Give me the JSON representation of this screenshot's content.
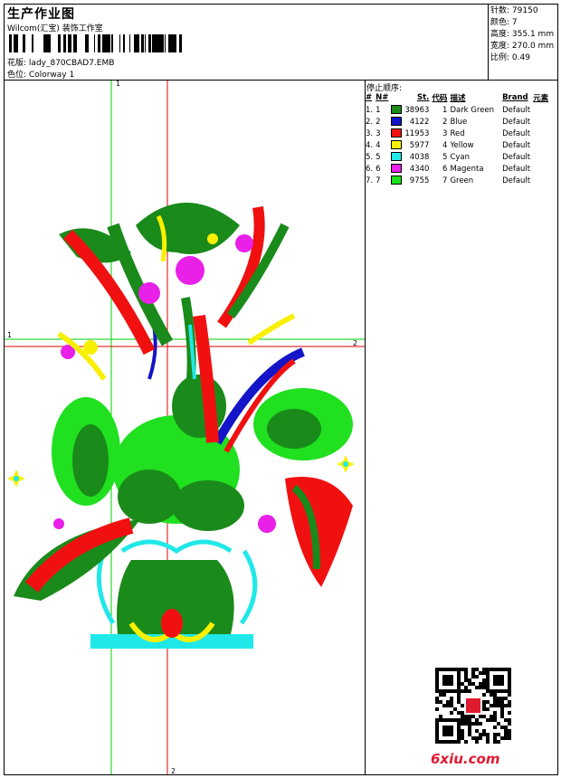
{
  "header": {
    "title": "生产作业图",
    "subtitle": "Wilcom(汇宝) 装饰工作室",
    "design_label": "花版:",
    "design_value": "lady_870CBAD7.EMB",
    "colorway_label": "色位:",
    "colorway_value": "Colorway 1"
  },
  "stats": [
    {
      "label": "针数:",
      "value": "79150"
    },
    {
      "label": "颜色:",
      "value": "7"
    },
    {
      "label": "高度:",
      "value": "355.1 mm"
    },
    {
      "label": "宽度:",
      "value": "270.0 mm"
    },
    {
      "label": "比例:",
      "value": "0.49"
    }
  ],
  "stop_sequence": {
    "title": "停止顺序:",
    "columns": [
      "#",
      "N#",
      "St.",
      "代码",
      "描述",
      "Brand",
      "元素"
    ],
    "rows": [
      {
        "idx": "1.",
        "n": "1",
        "color": "#1a8a1a",
        "stitches": "38963",
        "code": "1",
        "desc": "Dark Green",
        "brand": "Default"
      },
      {
        "idx": "2.",
        "n": "2",
        "color": "#1414c8",
        "stitches": "4122",
        "code": "2",
        "desc": "Blue",
        "brand": "Default"
      },
      {
        "idx": "3.",
        "n": "3",
        "color": "#f01010",
        "stitches": "11953",
        "code": "3",
        "desc": "Red",
        "brand": "Default"
      },
      {
        "idx": "4.",
        "n": "4",
        "color": "#f8f000",
        "stitches": "5977",
        "code": "4",
        "desc": "Yellow",
        "brand": "Default"
      },
      {
        "idx": "5.",
        "n": "5",
        "color": "#20e8e8",
        "stitches": "4038",
        "code": "5",
        "desc": "Cyan",
        "brand": "Default"
      },
      {
        "idx": "6.",
        "n": "6",
        "color": "#e820e8",
        "stitches": "4340",
        "code": "6",
        "desc": "Magenta",
        "brand": "Default"
      },
      {
        "idx": "7.",
        "n": "7",
        "color": "#20e020",
        "stitches": "9755",
        "code": "7",
        "desc": "Green",
        "brand": "Default"
      }
    ]
  },
  "axes": {
    "v1": "1",
    "v2": "2",
    "h1": "1",
    "h2": "2"
  },
  "colors": {
    "guide_green": "#00cc00",
    "guide_red": "#e00000"
  },
  "watermark": {
    "site": "6xiu.com"
  }
}
